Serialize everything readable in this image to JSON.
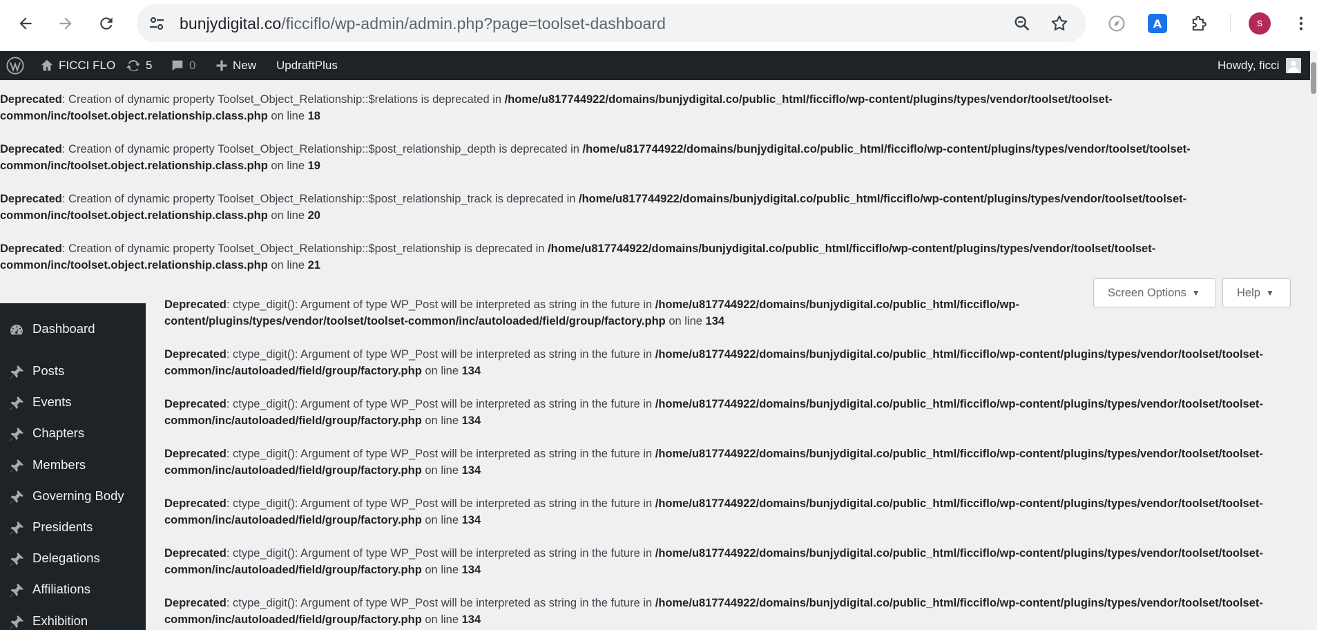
{
  "browser": {
    "url_host": "bunjydigital.co",
    "url_path": "/ficciflo/wp-admin/admin.php?page=toolset-dashboard",
    "profile_initial": "s",
    "colors": {
      "profile": "#b5285a",
      "translate_icon": "#1a73e8"
    }
  },
  "adminbar": {
    "site_name": "FICCI FLO",
    "updates_count": "5",
    "comments_count": "0",
    "new_label": "New",
    "updraft_label": "UpdraftPlus",
    "howdy": "Howdy, ficci"
  },
  "top_notices": [
    {
      "label": "Deprecated",
      "msg": ": Creation of dynamic property Toolset_Object_Relationship::$relations is deprecated in ",
      "path1": "/home/u817744922/domains/bunjydigital.co/public_html/ficciflo/wp-content/plugins/types/vendor/toolset/toolset-",
      "path2": "common/inc/toolset.object.relationship.class.php",
      "online": " on line ",
      "line": "18"
    },
    {
      "label": "Deprecated",
      "msg": ": Creation of dynamic property Toolset_Object_Relationship::$post_relationship_depth is deprecated in ",
      "path1": "/home/u817744922/domains/bunjydigital.co/public_html/ficciflo/wp-content/plugins/types/vendor/toolset/toolset-",
      "path2": "common/inc/toolset.object.relationship.class.php",
      "online": " on line ",
      "line": "19"
    },
    {
      "label": "Deprecated",
      "msg": ": Creation of dynamic property Toolset_Object_Relationship::$post_relationship_track is deprecated in ",
      "path1": "/home/u817744922/domains/bunjydigital.co/public_html/ficciflo/wp-content/plugins/types/vendor/toolset/toolset-",
      "path2": "common/inc/toolset.object.relationship.class.php",
      "online": " on line ",
      "line": "20"
    },
    {
      "label": "Deprecated",
      "msg": ": Creation of dynamic property Toolset_Object_Relationship::$post_relationship is deprecated in ",
      "path1": "/home/u817744922/domains/bunjydigital.co/public_html/ficciflo/wp-content/plugins/types/vendor/toolset/toolset-",
      "path2": "common/inc/toolset.object.relationship.class.php",
      "online": " on line ",
      "line": "21"
    }
  ],
  "screen_options": {
    "screen_options_label": "Screen Options",
    "help_label": "Help"
  },
  "sidebar": {
    "items": [
      {
        "label": "Dashboard",
        "icon": "dashboard-icon"
      },
      {
        "label": "Posts",
        "icon": "pin-icon"
      },
      {
        "label": "Events",
        "icon": "pin-icon"
      },
      {
        "label": "Chapters",
        "icon": "pin-icon"
      },
      {
        "label": "Members",
        "icon": "pin-icon"
      },
      {
        "label": "Governing Body",
        "icon": "pin-icon"
      },
      {
        "label": "Presidents",
        "icon": "pin-icon"
      },
      {
        "label": "Delegations",
        "icon": "pin-icon"
      },
      {
        "label": "Affiliations",
        "icon": "pin-icon"
      },
      {
        "label": "Exhibition",
        "icon": "pin-icon"
      }
    ]
  },
  "content_notices": [
    {
      "label": "Deprecated",
      "msg": ": ctype_digit(): Argument of type WP_Post will be interpreted as string in the future in ",
      "path1": "/home/u817744922/domains/bunjydigital.co/public_html/ficciflo/wp-",
      "path2": "content/plugins/types/vendor/toolset/toolset-common/inc/autoloaded/field/group/factory.php",
      "online": " on line ",
      "line": "134"
    },
    {
      "label": "Deprecated",
      "msg": ": ctype_digit(): Argument of type WP_Post will be interpreted as string in the future in ",
      "path1": "/home/u817744922/domains/bunjydigital.co/public_html/ficciflo/wp-content/plugins/types/vendor/toolset/toolset-",
      "path2": "common/inc/autoloaded/field/group/factory.php",
      "online": " on line ",
      "line": "134"
    },
    {
      "label": "Deprecated",
      "msg": ": ctype_digit(): Argument of type WP_Post will be interpreted as string in the future in ",
      "path1": "/home/u817744922/domains/bunjydigital.co/public_html/ficciflo/wp-content/plugins/types/vendor/toolset/toolset-",
      "path2": "common/inc/autoloaded/field/group/factory.php",
      "online": " on line ",
      "line": "134"
    },
    {
      "label": "Deprecated",
      "msg": ": ctype_digit(): Argument of type WP_Post will be interpreted as string in the future in ",
      "path1": "/home/u817744922/domains/bunjydigital.co/public_html/ficciflo/wp-content/plugins/types/vendor/toolset/toolset-",
      "path2": "common/inc/autoloaded/field/group/factory.php",
      "online": " on line ",
      "line": "134"
    },
    {
      "label": "Deprecated",
      "msg": ": ctype_digit(): Argument of type WP_Post will be interpreted as string in the future in ",
      "path1": "/home/u817744922/domains/bunjydigital.co/public_html/ficciflo/wp-content/plugins/types/vendor/toolset/toolset-",
      "path2": "common/inc/autoloaded/field/group/factory.php",
      "online": " on line ",
      "line": "134"
    },
    {
      "label": "Deprecated",
      "msg": ": ctype_digit(): Argument of type WP_Post will be interpreted as string in the future in ",
      "path1": "/home/u817744922/domains/bunjydigital.co/public_html/ficciflo/wp-content/plugins/types/vendor/toolset/toolset-",
      "path2": "common/inc/autoloaded/field/group/factory.php",
      "online": " on line ",
      "line": "134"
    },
    {
      "label": "Deprecated",
      "msg": ": ctype_digit(): Argument of type WP_Post will be interpreted as string in the future in ",
      "path1": "/home/u817744922/domains/bunjydigital.co/public_html/ficciflo/wp-content/plugins/types/vendor/toolset/toolset-",
      "path2": "common/inc/autoloaded/field/group/factory.php",
      "online": " on line ",
      "line": "134"
    }
  ]
}
